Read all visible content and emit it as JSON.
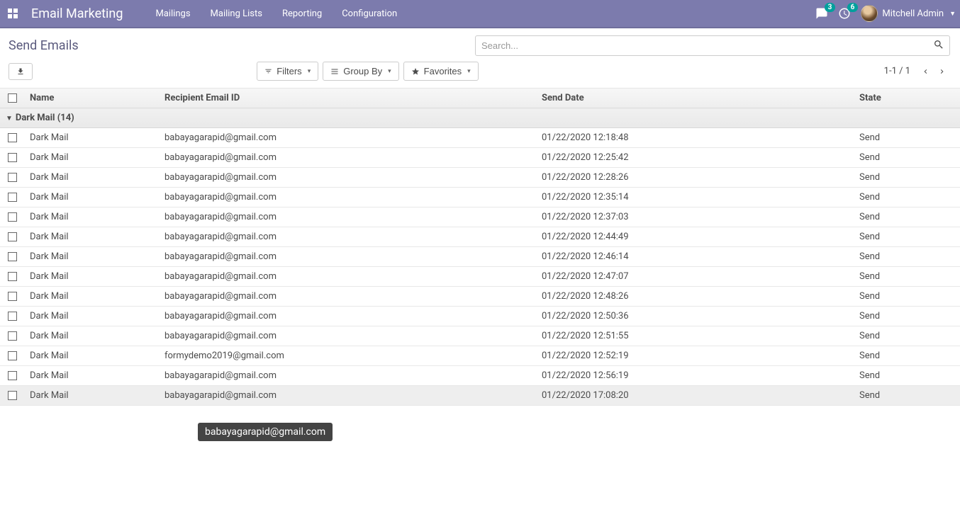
{
  "navbar": {
    "app_title": "Email Marketing",
    "menu": [
      "Mailings",
      "Mailing Lists",
      "Reporting",
      "Configuration"
    ],
    "conversation_badge": "3",
    "activity_badge": "6",
    "user_name": "Mitchell Admin"
  },
  "breadcrumb": "Send Emails",
  "search": {
    "placeholder": "Search..."
  },
  "toolbar": {
    "filters_label": "Filters",
    "groupby_label": "Group By",
    "favorites_label": "Favorites",
    "pager": "1-1 / 1"
  },
  "columns": {
    "name": "Name",
    "email": "Recipient Email ID",
    "date": "Send Date",
    "state": "State"
  },
  "group": {
    "label": "Dark Mail (14)"
  },
  "rows": [
    {
      "name": "Dark Mail",
      "email": "babayagarapid@gmail.com",
      "date": "01/22/2020 12:18:48",
      "state": "Send"
    },
    {
      "name": "Dark Mail",
      "email": "babayagarapid@gmail.com",
      "date": "01/22/2020 12:25:42",
      "state": "Send"
    },
    {
      "name": "Dark Mail",
      "email": "babayagarapid@gmail.com",
      "date": "01/22/2020 12:28:26",
      "state": "Send"
    },
    {
      "name": "Dark Mail",
      "email": "babayagarapid@gmail.com",
      "date": "01/22/2020 12:35:14",
      "state": "Send"
    },
    {
      "name": "Dark Mail",
      "email": "babayagarapid@gmail.com",
      "date": "01/22/2020 12:37:03",
      "state": "Send"
    },
    {
      "name": "Dark Mail",
      "email": "babayagarapid@gmail.com",
      "date": "01/22/2020 12:44:49",
      "state": "Send"
    },
    {
      "name": "Dark Mail",
      "email": "babayagarapid@gmail.com",
      "date": "01/22/2020 12:46:14",
      "state": "Send"
    },
    {
      "name": "Dark Mail",
      "email": "babayagarapid@gmail.com",
      "date": "01/22/2020 12:47:07",
      "state": "Send"
    },
    {
      "name": "Dark Mail",
      "email": "babayagarapid@gmail.com",
      "date": "01/22/2020 12:48:26",
      "state": "Send"
    },
    {
      "name": "Dark Mail",
      "email": "babayagarapid@gmail.com",
      "date": "01/22/2020 12:50:36",
      "state": "Send"
    },
    {
      "name": "Dark Mail",
      "email": "babayagarapid@gmail.com",
      "date": "01/22/2020 12:51:55",
      "state": "Send"
    },
    {
      "name": "Dark Mail",
      "email": "formydemo2019@gmail.com",
      "date": "01/22/2020 12:52:19",
      "state": "Send"
    },
    {
      "name": "Dark Mail",
      "email": "babayagarapid@gmail.com",
      "date": "01/22/2020 12:56:19",
      "state": "Send"
    },
    {
      "name": "Dark Mail",
      "email": "babayagarapid@gmail.com",
      "date": "01/22/2020 17:08:20",
      "state": "Send"
    }
  ],
  "tooltip": "babayagarapid@gmail.com"
}
